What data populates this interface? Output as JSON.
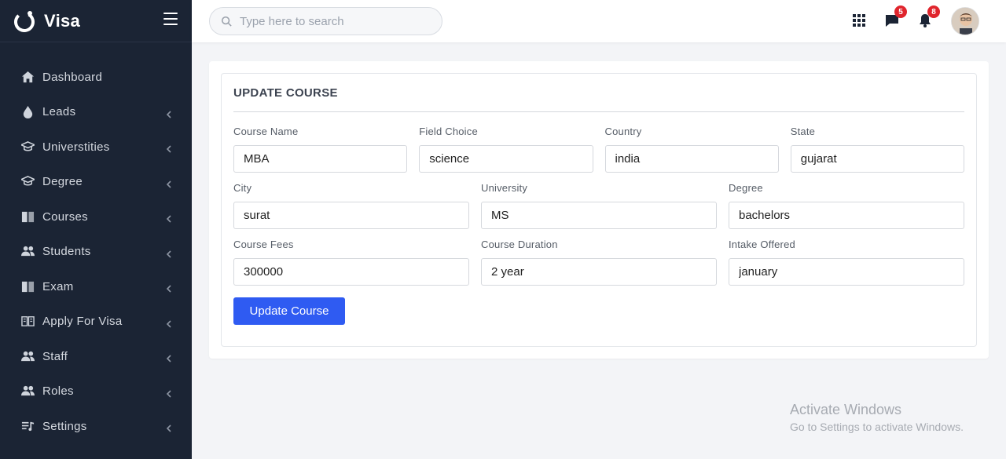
{
  "brand": {
    "name": "Visa"
  },
  "sidebar": {
    "items": [
      {
        "label": "Dashboard",
        "icon": "home-icon",
        "has_arrow": false
      },
      {
        "label": "Leads",
        "icon": "drop-icon",
        "has_arrow": true
      },
      {
        "label": "Universtities",
        "icon": "graduation-cap-icon",
        "has_arrow": true
      },
      {
        "label": "Degree",
        "icon": "graduation-cap-icon",
        "has_arrow": true
      },
      {
        "label": "Courses",
        "icon": "book-icon",
        "has_arrow": true
      },
      {
        "label": "Students",
        "icon": "users-icon",
        "has_arrow": true
      },
      {
        "label": "Exam",
        "icon": "book-icon",
        "has_arrow": true
      },
      {
        "label": "Apply For Visa",
        "icon": "open-book-icon",
        "has_arrow": true
      },
      {
        "label": "Staff",
        "icon": "users-icon",
        "has_arrow": true
      },
      {
        "label": "Roles",
        "icon": "users-icon",
        "has_arrow": true
      },
      {
        "label": "Settings",
        "icon": "settings-list-icon",
        "has_arrow": true
      }
    ]
  },
  "topbar": {
    "search_placeholder": "Type here to search",
    "messages_count": "5",
    "notifications_count": "8"
  },
  "form": {
    "title": "UPDATE COURSE",
    "rows": [
      [
        {
          "name": "course-name",
          "label": "Course Name",
          "value": "MBA"
        },
        {
          "name": "field-choice",
          "label": "Field Choice",
          "value": "science"
        },
        {
          "name": "country",
          "label": "Country",
          "value": "india"
        },
        {
          "name": "state",
          "label": "State",
          "value": "gujarat"
        }
      ],
      [
        {
          "name": "city",
          "label": "City",
          "value": "surat"
        },
        {
          "name": "university",
          "label": "University",
          "value": "MS"
        },
        {
          "name": "degree",
          "label": "Degree",
          "value": "bachelors"
        }
      ],
      [
        {
          "name": "course-fees",
          "label": "Course Fees",
          "value": "300000"
        },
        {
          "name": "course-duration",
          "label": "Course Duration",
          "value": "2 year"
        },
        {
          "name": "intake-offered",
          "label": "Intake Offered",
          "value": "january"
        }
      ]
    ],
    "submit_label": "Update Course"
  },
  "watermark": {
    "line1": "Activate Windows",
    "line2": "Go to Settings to activate Windows."
  },
  "colors": {
    "sidebar_bg": "#1b2434",
    "primary": "#2f5bf2",
    "badge": "#e0252d"
  }
}
